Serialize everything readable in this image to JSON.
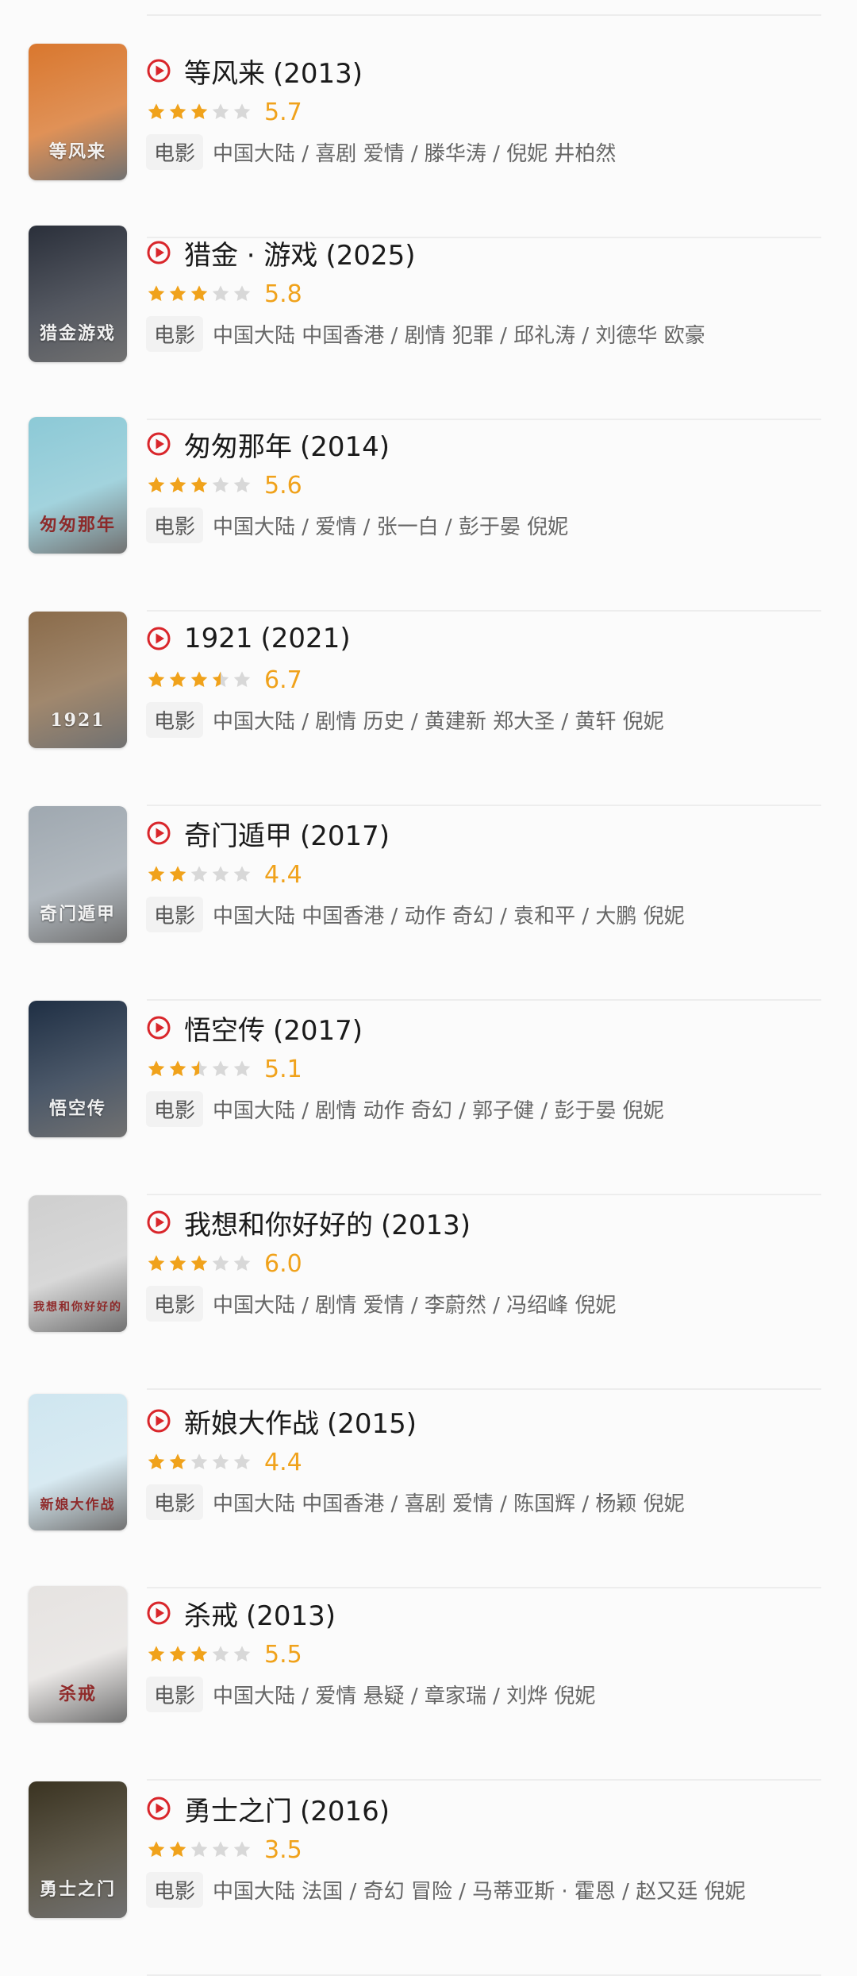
{
  "colors": {
    "play_red": "#d9262b",
    "star_gold": "#f0a21b",
    "star_gray": "#d8d8d8",
    "score": "#f0a21b"
  },
  "movies": [
    {
      "title": "等风来",
      "year": "(2013)",
      "score": "5.7",
      "stars": 3,
      "tag": "电影",
      "meta": "中国大陆 / 喜剧 爱情 / 滕华涛 / 倪妮 井柏然",
      "poster_text": "等风来",
      "poster_bg": "#d9772e"
    },
    {
      "title": "猎金 · 游戏",
      "year": "(2025)",
      "score": "5.8",
      "stars": 3,
      "tag": "电影",
      "meta": "中国大陆 中国香港 / 剧情 犯罪 / 邱礼涛 / 刘德华 欧豪",
      "poster_text": "猎金游戏",
      "poster_bg": "#2a2f3a"
    },
    {
      "title": "匆匆那年",
      "year": "(2014)",
      "score": "5.6",
      "stars": 3,
      "tag": "电影",
      "meta": "中国大陆 / 爱情 / 张一白 / 彭于晏 倪妮",
      "poster_text": "匆匆那年",
      "poster_bg": "#8cc9d6"
    },
    {
      "title": "1921",
      "year": "(2021)",
      "score": "6.7",
      "stars": 3.5,
      "tag": "电影",
      "meta": "中国大陆 / 剧情 历史 / 黄建新 郑大圣 / 黄轩 倪妮",
      "poster_text": "1921",
      "poster_bg": "#8a6b4a"
    },
    {
      "title": "奇门遁甲",
      "year": "(2017)",
      "score": "4.4",
      "stars": 2,
      "tag": "电影",
      "meta": "中国大陆 中国香港 / 动作 奇幻 / 袁和平 / 大鹏 倪妮",
      "poster_text": "奇门遁甲",
      "poster_bg": "#9fa8b0"
    },
    {
      "title": "悟空传",
      "year": "(2017)",
      "score": "5.1",
      "stars": 2.5,
      "tag": "电影",
      "meta": "中国大陆 / 剧情 动作 奇幻 / 郭子健 / 彭于晏 倪妮",
      "poster_text": "悟空传",
      "poster_bg": "#1f2f44"
    },
    {
      "title": "我想和你好好的",
      "year": "(2013)",
      "score": "6.0",
      "stars": 3,
      "tag": "电影",
      "meta": "中国大陆 / 剧情 爱情 / 李蔚然 / 冯绍峰 倪妮",
      "poster_text": "我想和你好好的",
      "poster_bg": "#cfcfcf"
    },
    {
      "title": "新娘大作战",
      "year": "(2015)",
      "score": "4.4",
      "stars": 2,
      "tag": "电影",
      "meta": "中国大陆 中国香港 / 喜剧 爱情 / 陈国辉 / 杨颖 倪妮",
      "poster_text": "新娘大作战",
      "poster_bg": "#cfe6f0"
    },
    {
      "title": "杀戒",
      "year": "(2013)",
      "score": "5.5",
      "stars": 3,
      "tag": "电影",
      "meta": "中国大陆 / 爱情 悬疑 / 章家瑞 / 刘烨 倪妮",
      "poster_text": "杀戒",
      "poster_bg": "#e6e3e1"
    },
    {
      "title": "勇士之门",
      "year": "(2016)",
      "score": "3.5",
      "stars": 2,
      "tag": "电影",
      "meta": "中国大陆 法国 / 奇幻 冒险 / 马蒂亚斯 · 霍恩 / 赵又廷 倪妮",
      "poster_text": "勇士之门",
      "poster_bg": "#3a3321"
    }
  ]
}
